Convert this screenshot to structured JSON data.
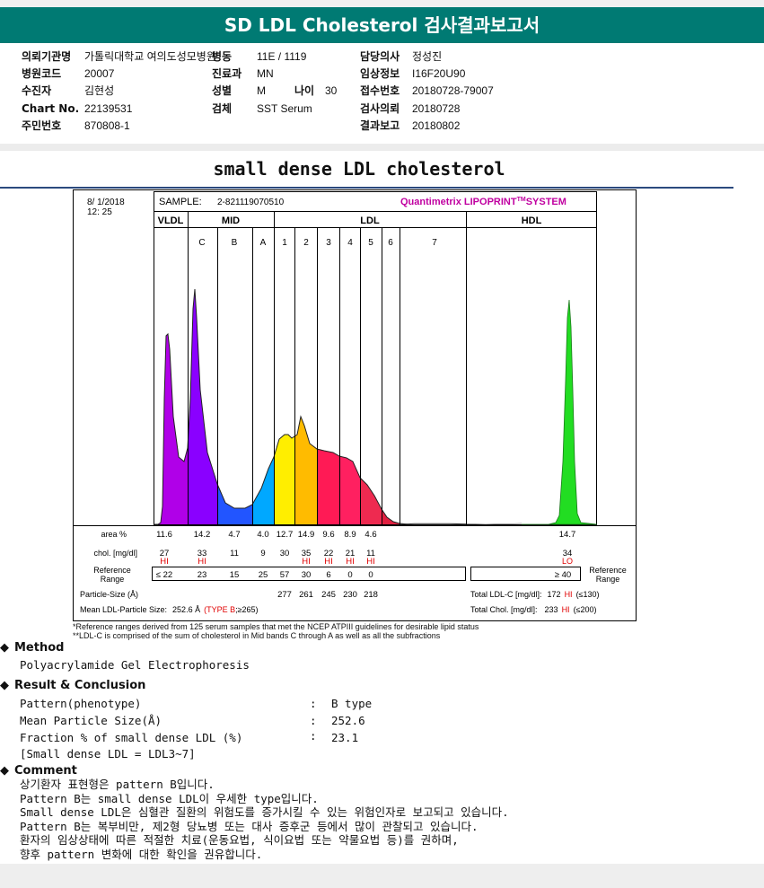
{
  "header": {
    "title": "SD LDL Cholesterol 검사결과보고서"
  },
  "info": {
    "rows": [
      [
        {
          "label": "의뢰기관명",
          "value": "가톨릭대학교 여의도성모병원"
        },
        {
          "label": "병동",
          "value": "11E / 1119"
        },
        {
          "label": "담당의사",
          "value": "정성진"
        }
      ],
      [
        {
          "label": "병원코드",
          "value": "20007"
        },
        {
          "label": "진료과",
          "value": "MN"
        },
        {
          "label": "임상정보",
          "value": "I16F20U90"
        }
      ],
      [
        {
          "label": "수진자",
          "value": "김현성"
        },
        {
          "label": "성별",
          "value": "M"
        },
        {
          "label": "접수번호",
          "value": "20180728-79007"
        }
      ],
      [
        {
          "label": "Chart No.",
          "value": "22139531"
        },
        {
          "label": "검체",
          "value": "SST Serum"
        },
        {
          "label": "검사의뢰",
          "value": "20180728"
        }
      ],
      [
        {
          "label": "주민번호",
          "value": "870808-1"
        },
        {
          "label": "결과보고",
          "value": "20180802"
        }
      ]
    ],
    "age_label": "나이",
    "age_value": "30"
  },
  "report": {
    "title": "small dense LDL cholesterol",
    "date": "8/ 1/2018",
    "time": "12: 25",
    "sample_label": "SAMPLE:",
    "sample_id": "2-821119070510",
    "system": "Quantimetrix LIPOPRINT",
    "system_tm": "TM",
    "system_suffix": "SYSTEM",
    "groups": [
      "VLDL",
      "MID",
      "LDL",
      "HDL"
    ],
    "bands": [
      "C",
      "B",
      "A",
      "1",
      "2",
      "3",
      "4",
      "5",
      "6",
      "7"
    ],
    "table": {
      "area_label": "area %",
      "area_values": [
        "11.6",
        "14.2",
        "4.7",
        "4.0",
        "12.7",
        "14.9",
        "9.6",
        "8.9",
        "4.6"
      ],
      "hdl_area": "14.7",
      "chol_label": "chol. [mg/dl]",
      "chol_values": [
        "27",
        "33",
        "11",
        "9",
        "30",
        "35",
        "22",
        "21",
        "11"
      ],
      "chol_flags": [
        "HI",
        "HI",
        "",
        "",
        "",
        "HI",
        "HI",
        "HI",
        "HI"
      ],
      "hdl_chol": "34",
      "hdl_flag": "LO",
      "ref_label_1": "Reference",
      "ref_label_2": "Range",
      "ref_values": [
        "≤ 22",
        "23",
        "15",
        "25",
        "57",
        "30",
        "6",
        "0",
        "0"
      ],
      "hdl_ref": "≥ 40",
      "size_label": "Particle-Size (Å)",
      "size_values": [
        "277",
        "261",
        "245",
        "230",
        "218"
      ],
      "mean_label": "Mean LDL-Particle Size:",
      "mean_value": "252.6 Å",
      "mean_type": "(TYPE B",
      "mean_ref": ";≥265)",
      "total_ldl_label": "Total LDL-C [mg/dl]:",
      "total_ldl_value": "172",
      "total_ldl_flag": "HI",
      "total_ldl_ref": "(≤130)",
      "total_chol_label": "Total Chol. [mg/dl]:",
      "total_chol_value": "233",
      "total_chol_flag": "HI",
      "total_chol_ref": "(≤200)"
    },
    "footnote_1": "*Reference ranges derived from 125 serum samples that met the NCEP ATPIII guidelines for desirable lipid status",
    "footnote_2": "**LDL-C is comprised of the sum of cholesterol in Mid bands C through A as well as all the subfractions"
  },
  "method": {
    "title": "Method",
    "text": "Polyacrylamide Gel Electrophoresis"
  },
  "result": {
    "title": "Result & Conclusion",
    "rows": [
      {
        "label": "Pattern(phenotype)",
        "value": "B type"
      },
      {
        "label": "Mean Particle Size(Å)",
        "value": "252.6"
      },
      {
        "label": "Fraction % of small dense LDL (%)",
        "value": "23.1"
      }
    ],
    "note": "[Small dense LDL = LDL3~7]"
  },
  "comment": {
    "title": "Comment",
    "lines": [
      "상기환자 표현형은 pattern B입니다.",
      "Pattern B는 small dense LDL이 우세한 type입니다.",
      "Small dense LDL은 심혈관 질환의 위험도를 증가시킬 수 있는 위험인자로 보고되고 있습니다.",
      "Pattern B는 복부비만, 제2형 당뇨병 또는 대사 증후군 등에서 많이 관찰되고 있습니다.",
      "환자의 임상상태에 따른 적절한 치료(운동요법, 식이요법 또는 약물요법 등)를 권하며,",
      "향후 pattern 변화에 대한 확인을 권유합니다."
    ]
  },
  "colors": {
    "banner": "#007a73",
    "vldl": "#b000e8",
    "mid_c": "#8a00ff",
    "mid_b": "#2255ff",
    "mid_a": "#00a8ff",
    "ldl1": "#ffee00",
    "ldl2": "#ffbb00",
    "ldl3": "#ff1a55",
    "ldl4": "#ff2060",
    "ldl5": "#ee2a50",
    "ldl6": "#e02040",
    "hdl": "#22dd22",
    "flag": "#e00000",
    "system": "#c000a0"
  }
}
